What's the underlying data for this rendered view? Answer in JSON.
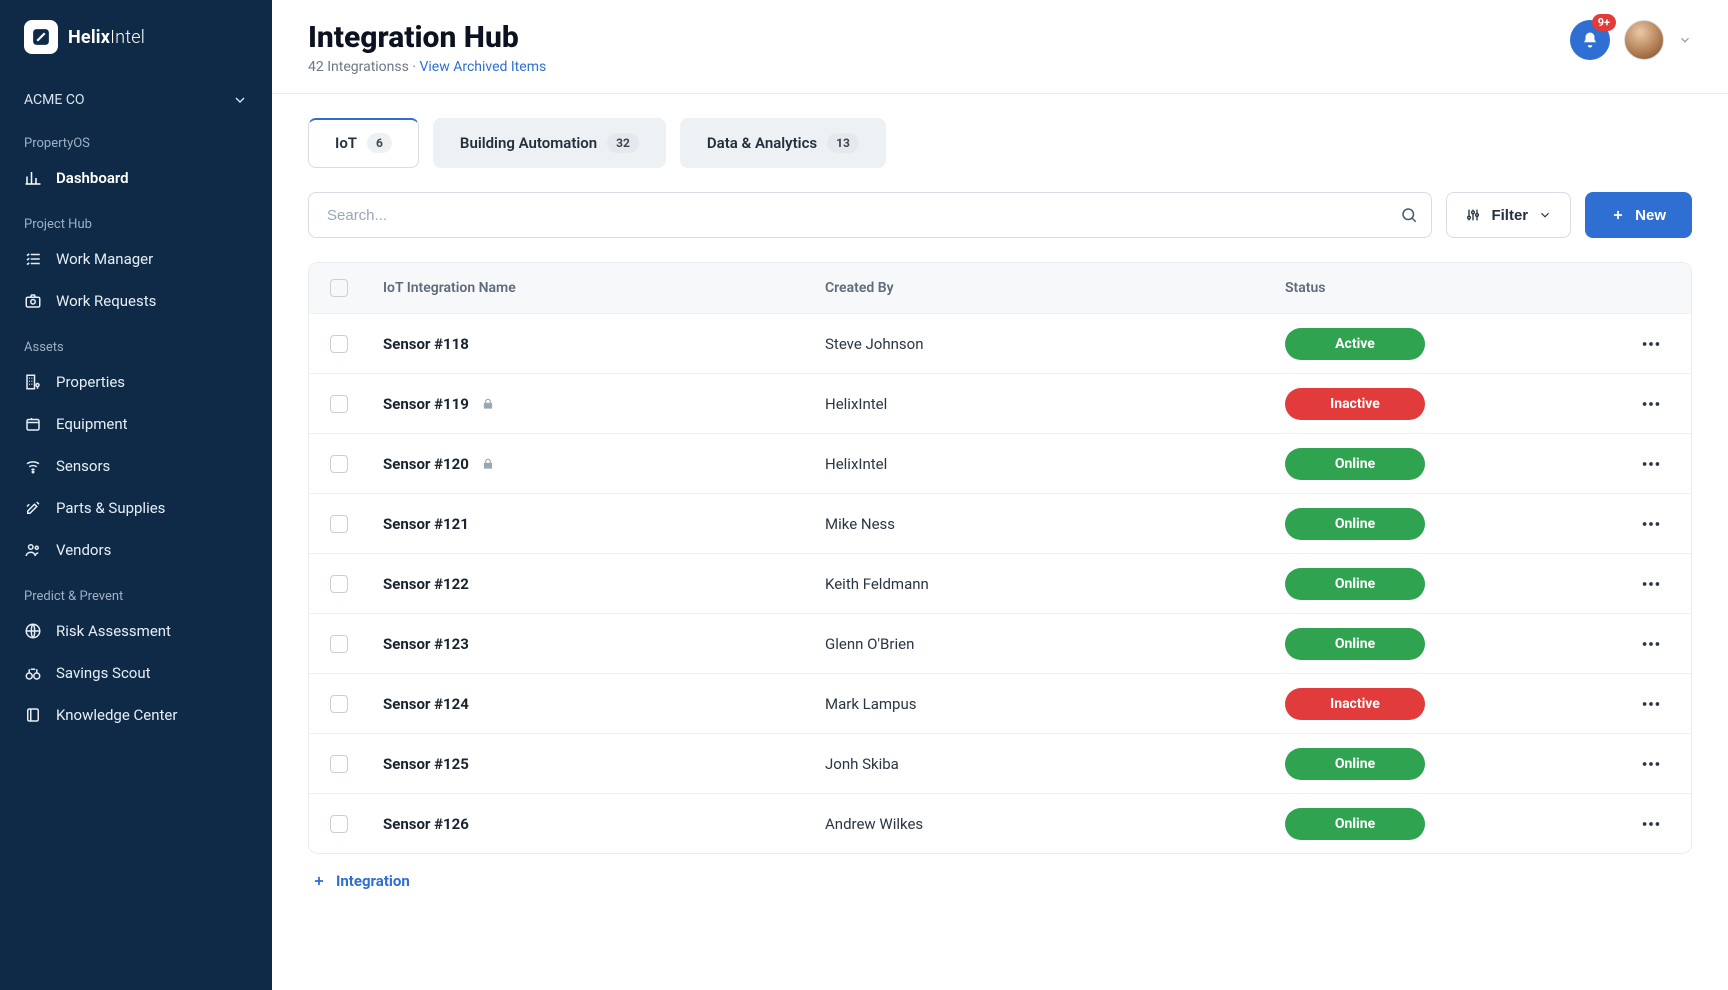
{
  "brand": {
    "name_bold": "Helix",
    "name_light": "Intel"
  },
  "org": {
    "name": "ACME CO"
  },
  "sidebar": {
    "sections": [
      {
        "title": "PropertyOS",
        "items": [
          {
            "label": "Dashboard",
            "icon": "chart-bar-icon",
            "active": true
          }
        ]
      },
      {
        "title": "Project Hub",
        "items": [
          {
            "label": "Work Manager",
            "icon": "list-check-icon"
          },
          {
            "label": "Work Requests",
            "icon": "camera-icon"
          }
        ]
      },
      {
        "title": "Assets",
        "items": [
          {
            "label": "Properties",
            "icon": "building-pin-icon"
          },
          {
            "label": "Equipment",
            "icon": "package-icon"
          },
          {
            "label": "Sensors",
            "icon": "wifi-icon"
          },
          {
            "label": "Parts & Supplies",
            "icon": "tools-icon"
          },
          {
            "label": "Vendors",
            "icon": "users-icon"
          }
        ]
      },
      {
        "title": "Predict & Prevent",
        "items": [
          {
            "label": "Risk Assessment",
            "icon": "globe-icon"
          },
          {
            "label": "Savings Scout",
            "icon": "binoculars-icon"
          },
          {
            "label": "Knowledge Center",
            "icon": "book-icon"
          }
        ]
      }
    ]
  },
  "header": {
    "title": "Integration Hub",
    "subtitle_count": "42 Integrationss",
    "subtitle_separator": " · ",
    "archived_link": "View Archived Items",
    "notifications_badge": "9+"
  },
  "tabs": [
    {
      "label": "IoT",
      "count": "6",
      "active": true
    },
    {
      "label": "Building Automation",
      "count": "32"
    },
    {
      "label": "Data & Analytics",
      "count": "13"
    }
  ],
  "controls": {
    "search_placeholder": "Search...",
    "filter_label": "Filter",
    "new_label": "New"
  },
  "table": {
    "columns": {
      "name": "IoT Integration Name",
      "created_by": "Created By",
      "status": "Status"
    },
    "rows": [
      {
        "name": "Sensor #118",
        "locked": false,
        "created_by": "Steve Johnson",
        "status": "Active"
      },
      {
        "name": "Sensor #119",
        "locked": true,
        "created_by": "HelixIntel",
        "status": "Inactive"
      },
      {
        "name": "Sensor #120",
        "locked": true,
        "created_by": "HelixIntel",
        "status": "Online"
      },
      {
        "name": "Sensor #121",
        "locked": false,
        "created_by": "Mike Ness",
        "status": "Online"
      },
      {
        "name": "Sensor #122",
        "locked": false,
        "created_by": "Keith Feldmann",
        "status": "Online"
      },
      {
        "name": "Sensor #123",
        "locked": false,
        "created_by": "Glenn O'Brien",
        "status": "Online"
      },
      {
        "name": "Sensor #124",
        "locked": false,
        "created_by": "Mark Lampus",
        "status": "Inactive"
      },
      {
        "name": "Sensor #125",
        "locked": false,
        "created_by": "Jonh Skiba",
        "status": "Online"
      },
      {
        "name": "Sensor #126",
        "locked": false,
        "created_by": "Andrew Wilkes",
        "status": "Online"
      }
    ]
  },
  "footer_action": {
    "label": "Integration"
  }
}
